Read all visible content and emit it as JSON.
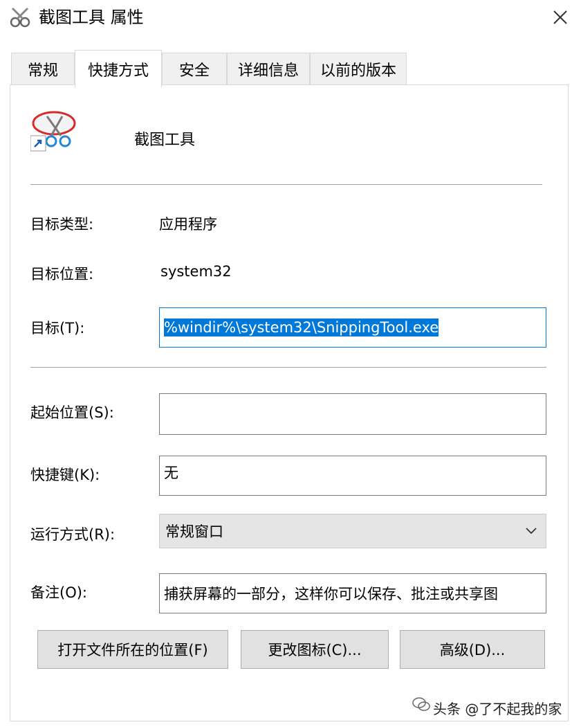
{
  "window": {
    "title": "截图工具 属性",
    "app_icon": "scissors-icon",
    "close_icon": "close-icon"
  },
  "tabs": [
    {
      "label": "常规",
      "active": false
    },
    {
      "label": "快捷方式",
      "active": true
    },
    {
      "label": "安全",
      "active": false
    },
    {
      "label": "详细信息",
      "active": false
    },
    {
      "label": "以前的版本",
      "active": false
    }
  ],
  "shortcut": {
    "name": "截图工具",
    "icon": "snipping-tool-icon"
  },
  "fields": {
    "target_type_label": "目标类型:",
    "target_type_value": "应用程序",
    "target_location_label": "目标位置:",
    "target_location_value": "system32",
    "target_label": "目标(T):",
    "target_value": "%windir%\\system32\\SnippingTool.exe",
    "start_in_label": "起始位置(S):",
    "start_in_value": "",
    "hotkey_label": "快捷键(K):",
    "hotkey_value": "无",
    "run_label": "运行方式(R):",
    "run_value": "常规窗口",
    "comment_label": "备注(O):",
    "comment_value": "捕获屏幕的一部分，这样你可以保存、批注或共享图"
  },
  "buttons": {
    "open_location": "打开文件所在的位置(F)",
    "change_icon": "更改图标(C)...",
    "advanced": "高级(D)..."
  },
  "watermark": {
    "text": "头条 @了不起我的家"
  },
  "colors": {
    "selection": "#0078d7",
    "focus_border": "#0078d7"
  }
}
